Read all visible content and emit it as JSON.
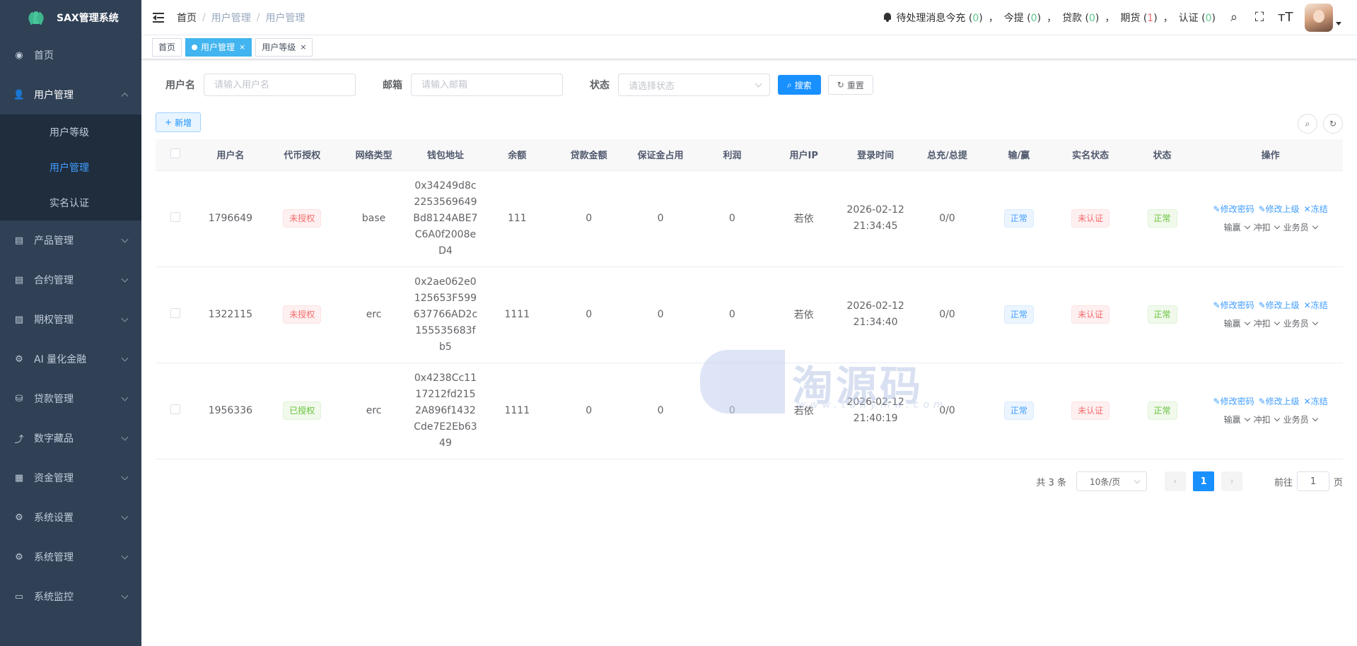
{
  "app": {
    "title": "SAX管理系统"
  },
  "sidebar": {
    "items": [
      {
        "label": "首页",
        "icon": "dashboard-icon",
        "glyph": "◉"
      },
      {
        "label": "用户管理",
        "icon": "user-icon",
        "glyph": "👤",
        "open": true,
        "children": [
          {
            "label": "用户等级",
            "active": false
          },
          {
            "label": "用户管理",
            "active": true
          },
          {
            "label": "实名认证",
            "active": false
          }
        ]
      },
      {
        "label": "产品管理",
        "icon": "document-icon",
        "glyph": "▤"
      },
      {
        "label": "合约管理",
        "icon": "document-icon",
        "glyph": "▤"
      },
      {
        "label": "期权管理",
        "icon": "chart-icon",
        "glyph": "▨"
      },
      {
        "label": "AI 量化金融",
        "icon": "gear-small-icon",
        "glyph": "⚙"
      },
      {
        "label": "贷款管理",
        "icon": "money-icon",
        "glyph": "⛁"
      },
      {
        "label": "数字藏品",
        "icon": "trend-icon",
        "glyph": "⤴"
      },
      {
        "label": "资金管理",
        "icon": "wallet-icon",
        "glyph": "▦"
      },
      {
        "label": "系统设置",
        "icon": "gear-icon",
        "glyph": "⚙"
      },
      {
        "label": "系统管理",
        "icon": "gear-icon",
        "glyph": "⚙"
      },
      {
        "label": "系统监控",
        "icon": "monitor-icon",
        "glyph": "▭"
      }
    ]
  },
  "navbar": {
    "breadcrumb": [
      "首页",
      "用户管理",
      "用户管理"
    ],
    "pending_label": "待处理消息",
    "pending": [
      {
        "label": "今充",
        "count": "0",
        "alert": false
      },
      {
        "label": "今提",
        "count": "0",
        "alert": false
      },
      {
        "label": "贷款",
        "count": "0",
        "alert": false
      },
      {
        "label": "期货",
        "count": "1",
        "alert": true
      },
      {
        "label": "认证",
        "count": "0",
        "alert": false
      }
    ]
  },
  "tags": [
    {
      "label": "首页",
      "active": false,
      "closable": false
    },
    {
      "label": "用户管理",
      "active": true,
      "closable": true
    },
    {
      "label": "用户等级",
      "active": false,
      "closable": true
    }
  ],
  "search": {
    "username_label": "用户名",
    "username_placeholder": "请输入用户名",
    "email_label": "邮箱",
    "email_placeholder": "请输入邮箱",
    "status_label": "状态",
    "status_placeholder": "请选择状态",
    "search_button": "搜索",
    "reset_button": "重置"
  },
  "toolbar": {
    "add_button": "新增"
  },
  "table": {
    "columns": [
      "用户名",
      "代币授权",
      "网络类型",
      "钱包地址",
      "余额",
      "贷款金额",
      "保证金占用",
      "利润",
      "用户IP",
      "登录时间",
      "总充/总提",
      "输/赢",
      "实名状态",
      "状态",
      "操作"
    ],
    "rows": [
      {
        "username": "1796649",
        "auth": "未授权",
        "auth_ok": false,
        "network": "base",
        "wallet": "0x34249d8c2253569649Bd8124ABE7C6A0f2008eD4",
        "balance": "111",
        "loan": "0",
        "margin": "0",
        "profit": "0",
        "ip": "若依",
        "login_date": "2026-02-12",
        "login_time": "21:34:45",
        "deposit": "0/0",
        "winlose": "正常",
        "kyc": "未认证",
        "status": "正常"
      },
      {
        "username": "1322115",
        "auth": "未授权",
        "auth_ok": false,
        "network": "erc",
        "wallet": "0x2ae062e0125653F599637766AD2c155535683fb5",
        "balance": "1111",
        "loan": "0",
        "margin": "0",
        "profit": "0",
        "ip": "若依",
        "login_date": "2026-02-12",
        "login_time": "21:34:40",
        "deposit": "0/0",
        "winlose": "正常",
        "kyc": "未认证",
        "status": "正常"
      },
      {
        "username": "1956336",
        "auth": "已授权",
        "auth_ok": true,
        "network": "erc",
        "wallet": "0x4238Cc1117212fd2152A896f1432Cde7E2Eb6349",
        "balance": "1111",
        "loan": "0",
        "margin": "0",
        "profit": "0",
        "ip": "若依",
        "login_date": "2026-02-12",
        "login_time": "21:40:19",
        "deposit": "0/0",
        "winlose": "正常",
        "kyc": "未认证",
        "status": "正常"
      }
    ],
    "ops": {
      "edit_password": "修改密码",
      "edit_parent": "修改上级",
      "freeze": "冻结",
      "dd_winlose": "输赢",
      "dd_offset": "冲扣",
      "dd_agent": "业务员"
    }
  },
  "pagination": {
    "total_text": "共 3 条",
    "page_size": "10条/页",
    "current_page": "1",
    "goto_label": "前往",
    "goto_value": "1",
    "page_unit": "页"
  },
  "watermark": {
    "text": "淘源码",
    "url": "www.tanymw.com"
  },
  "colors": {
    "sidebar_bg": "#304156",
    "accent": "#1890ff",
    "tag_active": "#42b4f0",
    "ok_green": "#5cc98c",
    "alert_red": "#f56c6c"
  }
}
